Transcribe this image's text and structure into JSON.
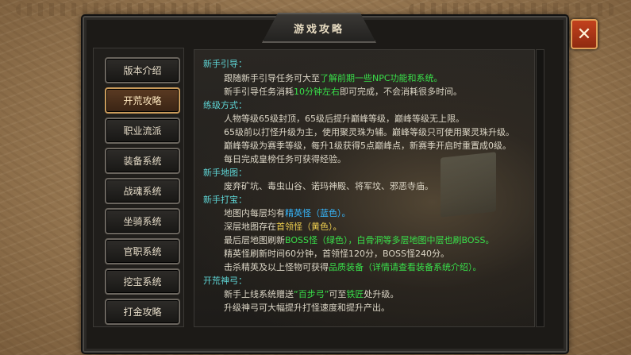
{
  "window": {
    "title": "游戏攻略",
    "close_label": "✕"
  },
  "nav": [
    {
      "label": "版本介绍"
    },
    {
      "label": "开荒攻略",
      "active": true
    },
    {
      "label": "职业流派"
    },
    {
      "label": "装备系统"
    },
    {
      "label": "战魂系统"
    },
    {
      "label": "坐骑系统"
    },
    {
      "label": "官职系统"
    },
    {
      "label": "挖宝系统"
    },
    {
      "label": "打金攻略"
    }
  ],
  "content": {
    "s1": {
      "heading": "新手引导：",
      "l1a": "跟随新手引导任务可大至",
      "l1b": "了解前期一些NPC功能和系统。",
      "l2a": "新手引导任务消耗",
      "l2b": "10分钟左右",
      "l2c": "即可完成，不会消耗很多时间。"
    },
    "s2": {
      "heading": "练级方式：",
      "l1": "人物等级65级封顶，65级后提升巅峰等级，巅峰等级无上限。",
      "l2": "65级前以打怪升级为主，使用聚灵珠为辅。巅峰等级只可使用聚灵珠升级。",
      "l3": "巅峰等级为赛季等级，每升1级获得5点巅峰点，新赛季开启时重置成0级。",
      "l4": "每日完成皇榜任务可获得经验。"
    },
    "s3": {
      "heading": "新手地图：",
      "l1": "废弃矿坑、毒虫山谷、诺玛神殿、将军坟、邪恶寺庙。"
    },
    "s4": {
      "heading": "新手打宝：",
      "l1a": "地图内每层均有",
      "l1b": "精英怪（蓝色）。",
      "l2a": "深层地图存在",
      "l2b": "首领怪（黄色）。",
      "l3a": "最后层地图刷新",
      "l3b": "BOSS怪（绿色），白骨洞等多层地图中层也刷BOSS。",
      "l4": "精英怪刷新时间60分钟，首领怪120分，BOSS怪240分。",
      "l5a": "击杀精英及以上怪物可获得",
      "l5b": "品质装备（详情请查看装备系统介绍）。"
    },
    "s5": {
      "heading": "开荒神弓：",
      "l1a": "新手上线系统赠送",
      "l1b": "“百步弓”",
      "l1c": "可至",
      "l1d": "铁匠",
      "l1e": "处升级。",
      "l2": "升级神弓可大幅提升打怪速度和提升产出。"
    }
  },
  "colors": {
    "heading": "#5fd6d6",
    "green": "#39e04a",
    "blue": "#36b8ff",
    "yellow": "#f0d050",
    "body": "#dcd6c6"
  },
  "icons": {
    "close": "close-icon"
  }
}
